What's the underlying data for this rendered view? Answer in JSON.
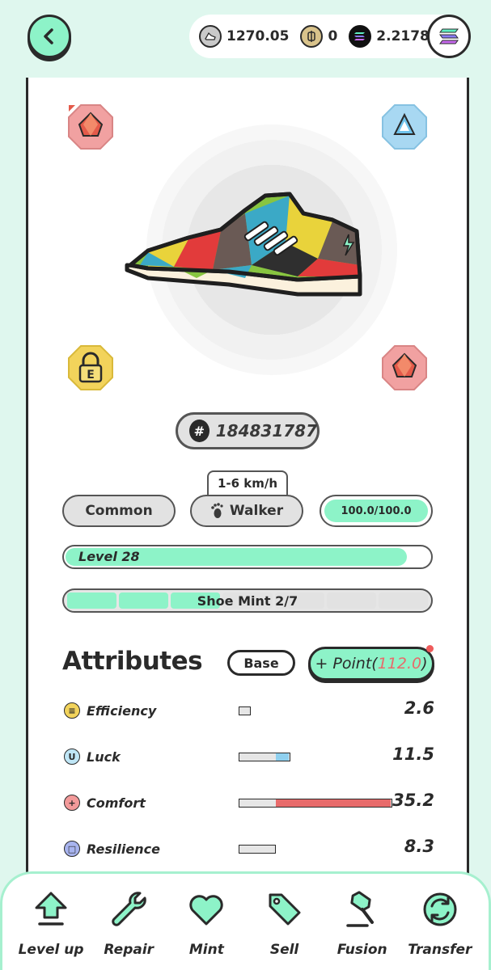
{
  "header": {
    "balances": [
      {
        "icon": "gst-coin-icon",
        "value": "1270.05"
      },
      {
        "icon": "gmt-coin-icon",
        "value": "0"
      },
      {
        "icon": "sol-coin-icon",
        "value": "2.2178"
      }
    ]
  },
  "sneaker": {
    "id_prefix": "#",
    "id": "184831787",
    "speed": "1-6 km/h",
    "quality": "Common",
    "type": "Walker",
    "durability": "100.0/100.0",
    "durability_fraction": 1.0,
    "level_label": "Level 28",
    "level_progress": 0.93,
    "mint_label": "Shoe Mint 2/7",
    "mint_count": 2,
    "mint_max": 7
  },
  "sockets": [
    {
      "position": "top-left",
      "type": "comfort-gem",
      "color": "#e86b6b"
    },
    {
      "position": "top-right",
      "type": "luck-gem",
      "color": "#8fd0ef"
    },
    {
      "position": "bottom-left",
      "type": "locked",
      "letter": "E",
      "color": "#f2d35b"
    },
    {
      "position": "bottom-right",
      "type": "comfort-gem",
      "color": "#e86b6b"
    }
  ],
  "attributes": {
    "title": "Attributes",
    "base_label": "Base",
    "point_prefix": "+ Point(",
    "point_value": "112.0",
    "point_suffix": ")",
    "rows": [
      {
        "name": "Efficiency",
        "glyph": "≡",
        "color": "#f2d35b",
        "value": "2.6",
        "base": 2.6,
        "bonus": 0
      },
      {
        "name": "Luck",
        "glyph": "U",
        "color": "#bfe6f6",
        "value": "11.5",
        "base": 8.5,
        "bonus": 3.0
      },
      {
        "name": "Comfort",
        "glyph": "+",
        "color": "#f39a9a",
        "value": "35.2",
        "base": 8.5,
        "bonus": 26.7
      },
      {
        "name": "Resilience",
        "glyph": "□",
        "color": "#a8b4ef",
        "value": "8.3",
        "base": 8.3,
        "bonus": 0
      }
    ]
  },
  "nav": [
    {
      "label": "Level up",
      "icon": "level-up-arrow-icon"
    },
    {
      "label": "Repair",
      "icon": "wrench-icon"
    },
    {
      "label": "Mint",
      "icon": "heart-icon"
    },
    {
      "label": "Sell",
      "icon": "price-tag-icon"
    },
    {
      "label": "Fusion",
      "icon": "hammer-icon"
    },
    {
      "label": "Transfer",
      "icon": "transfer-arrows-icon"
    }
  ],
  "colors": {
    "accent": "#8df3c8",
    "background": "#dff7ee",
    "outline": "#2a2a2a",
    "comfort": "#e86b6b",
    "luck": "#8fd0ef"
  }
}
